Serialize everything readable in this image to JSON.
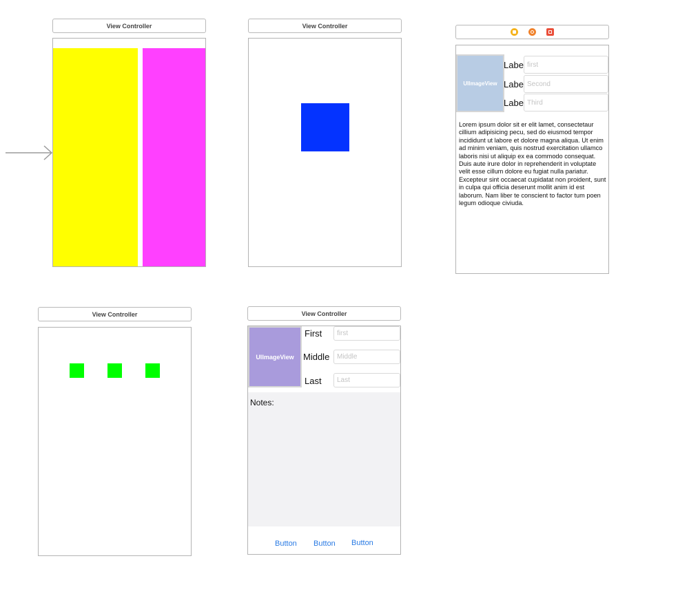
{
  "scene1": {
    "title": "View Controller",
    "colors": {
      "left": "#ffff00",
      "right": "#ff40ff"
    }
  },
  "entry_arrow": {
    "icon": "entry-arrow-icon"
  },
  "scene2": {
    "title": "View Controller",
    "colors": {
      "square": "#0433ff"
    }
  },
  "scene3": {
    "toolbar_icons": [
      "view-controller-icon",
      "first-responder-icon",
      "exit-icon"
    ],
    "image_view_label": "UIImageView",
    "rows": [
      {
        "label": "Label",
        "placeholder": "first"
      },
      {
        "label": "Label",
        "placeholder": "Second"
      },
      {
        "label": "Label",
        "placeholder": "Third"
      }
    ],
    "body_text": "Lorem ipsum dolor sit er elit lamet, consectetaur cillium adipisicing pecu, sed do eiusmod tempor incididunt ut labore et dolore magna aliqua. Ut enim ad minim veniam, quis nostrud exercitation ullamco laboris nisi ut aliquip ex ea commodo consequat. Duis aute irure dolor in reprehenderit in voluptate velit esse cillum dolore eu fugiat nulla pariatur. Excepteur sint occaecat cupidatat non proident, sunt in culpa qui officia deserunt mollit anim id est laborum. Nam liber te conscient to factor tum poen legum odioque civiuda.",
    "colors": {
      "image_view": "#b8cce4"
    }
  },
  "scene4": {
    "title": "View Controller",
    "colors": {
      "square": "#00ff00"
    }
  },
  "scene5": {
    "title": "View Controller",
    "image_view_label": "UIImageView",
    "rows": [
      {
        "label": "First",
        "placeholder": "first"
      },
      {
        "label": "Middle",
        "placeholder": "Middle"
      },
      {
        "label": "Last",
        "placeholder": "Last"
      }
    ],
    "notes_label": "Notes:",
    "buttons": [
      "Button",
      "Button",
      "Button"
    ],
    "colors": {
      "image_view": "#a99bdc",
      "notes_bg": "#f2f2f4"
    }
  }
}
